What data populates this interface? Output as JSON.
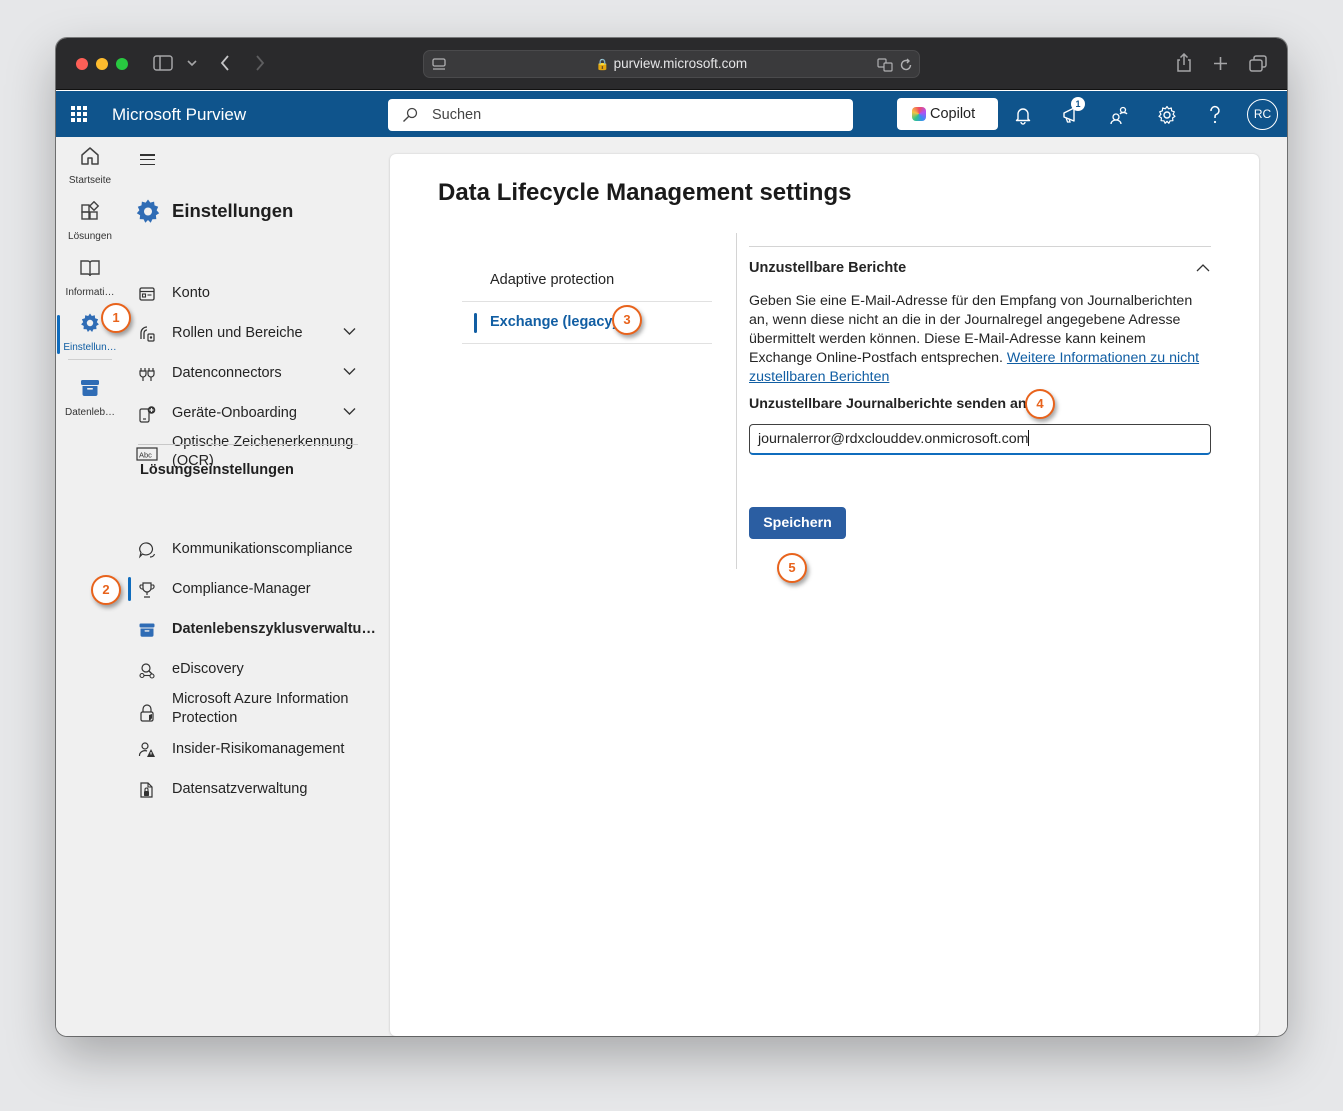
{
  "browser": {
    "url": "purview.microsoft.com"
  },
  "app": {
    "title": "Microsoft Purview",
    "search_placeholder": "Suchen",
    "copilot_label": "Copilot",
    "notification_count": "1",
    "avatar_initials": "RC"
  },
  "rail": {
    "items": [
      {
        "label": "Startseite",
        "icon": "home-icon"
      },
      {
        "label": "Lösungen",
        "icon": "solutions-icon"
      },
      {
        "label": "Informati…",
        "icon": "book-icon"
      },
      {
        "label": "Einstellun…",
        "icon": "gear-icon",
        "active": true
      },
      {
        "label": "Datenleb…",
        "icon": "archive-icon"
      }
    ]
  },
  "nav": {
    "heading": "Einstellungen",
    "items": [
      {
        "label": "Konto",
        "icon": "account-icon"
      },
      {
        "label": "Rollen und Bereiche",
        "icon": "roles-icon",
        "expandable": true
      },
      {
        "label": "Datenconnectors",
        "icon": "connector-icon",
        "expandable": true
      },
      {
        "label": "Geräte-Onboarding",
        "icon": "device-icon",
        "expandable": true
      },
      {
        "label": "Optische Zeichenerkennung (OCR)",
        "icon": "ocr-icon"
      }
    ],
    "section_title": "Lösungseinstellungen",
    "solution_items": [
      {
        "label": "Kommunikationscompliance",
        "icon": "chat-icon"
      },
      {
        "label": "Compliance-Manager",
        "icon": "trophy-icon"
      },
      {
        "label": "Datenlebenszyklusverwaltu…",
        "icon": "archive-icon",
        "active": true
      },
      {
        "label": "eDiscovery",
        "icon": "ediscovery-icon"
      },
      {
        "label": "Microsoft Azure Information Protection",
        "icon": "protection-icon"
      },
      {
        "label": "Insider-Risikomanagement",
        "icon": "insider-risk-icon"
      },
      {
        "label": "Datensatzverwaltung",
        "icon": "records-icon"
      }
    ]
  },
  "main": {
    "title": "Data Lifecycle Management settings",
    "tabs": [
      {
        "label": "Adaptive protection"
      },
      {
        "label": "Exchange (legacy)",
        "active": true
      }
    ],
    "section": {
      "title": "Unzustellbare Berichte",
      "description": "Geben Sie eine E-Mail-Adresse für den Empfang von Journalberichten an, wenn diese nicht an die in der Journalregel angegebene Adresse übermittelt werden können. Diese E-Mail-Adresse kann keinem Exchange Online-Postfach entsprechen. ",
      "link": "Weitere Informationen zu nicht zustellbaren Berichten",
      "field_label": "Unzustellbare Journalberichte senden an:",
      "required_mark": "*",
      "field_value": "journalerror@rdxclouddev.onmicrosoft.com",
      "save_label": "Speichern"
    }
  },
  "markers": [
    "1",
    "2",
    "3",
    "4",
    "5"
  ],
  "colors": {
    "header_blue": "#0f548c",
    "accent": "#115ea3",
    "marker_orange": "#e8631c",
    "button": "#2b5ea2"
  }
}
